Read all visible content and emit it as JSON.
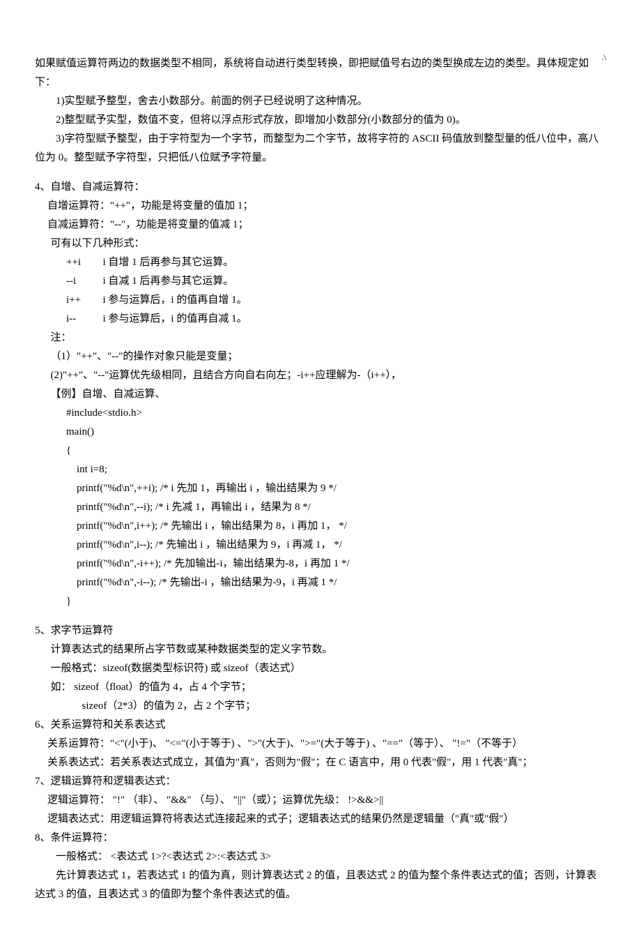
{
  "page_marker": ".\\",
  "intro_line": "如果赋值运算符两边的数据类型不相同，系统将自动进行类型转换，即把赋值号右边的类型换成左边的类型。具体规定如下：",
  "rules": {
    "r1": "1)实型赋予整型，舍去小数部分。前面的例子已经说明了这种情况。",
    "r2": "2)整型赋予实型，数值不变，但将以浮点形式存放，即增加小数部分(小数部分的值为 0)。",
    "r3": "3)字符型赋予整型，由于字符型为一个字节，而整型为二个字节，故将字符的 ASCII 码值放到整型量的低八位中，高八位为 0。整型赋予字符型，只把低八位赋予字符量。"
  },
  "sec4": {
    "title": "4、自增、自减运算符：",
    "bullet": "",
    "item1": "自增运算符：\"++\"，功能是将变量的值加 1；",
    "item2": "自减运算符：\"--\"，功能是将变量的值减 1；",
    "forms_label": "可有以下几种形式：",
    "forms": {
      "f1k": "++i",
      "f1v": "i 自增 1 后再参与其它运算。",
      "f2k": "--i",
      "f2v": "i 自减 1 后再参与其它运算。",
      "f3k": "i++",
      "f3v": "i 参与运算后，i 的值再自增 1。",
      "f4k": "i--",
      "f4v": "i 参与运算后，i 的值再自减 1。"
    },
    "note_label": "注：",
    "note1": "（1）\"++\"、\"--\"的操作对象只能是变量；",
    "note2": "(2)\"++\"、\"--\"运算优先级相同，且结合方向自右向左；-i++应理解为-（i++），",
    "example_label": "【例】自增、自减运算、",
    "code": {
      "l1": "#include<stdio.h>",
      "l2": "main()",
      "l3": "{",
      "l4": "int i=8;",
      "l5": "printf(\"%d\\n\",++i);   /* i 先加 1，再输出 i ，输出结果为 9 */",
      "l6": "printf(\"%d\\n\",--i);    /* i 先减 1，再输出 i ，结果为 8 */",
      "l7": "printf(\"%d\\n\",i++);  /*  先输出 i ，输出结果为 8，i 再加 1，   */",
      "l8": "printf(\"%d\\n\",i--);   /*  先输出 i ，输出结果为 9，i 再减 1，   */",
      "l9": "printf(\"%d\\n\",-i++);  /*  先加输出-i，输出结果为-8，i 再加 1 */",
      "l10": "printf(\"%d\\n\",-i--);   /*  先输出-i ，输出结果为-9，i 再减 1 */",
      "l11": "}"
    }
  },
  "sec5": {
    "title": "5、求字节运算符",
    "line1": "计算表达式的结果所占字节数或某种数据类型的定义字节数。",
    "line2": "一般格式：sizeof(数据类型标识符)    或    sizeof（表达式）",
    "line3": "如：  sizeof（float）的值为 4，占 4 个字节；",
    "line4": "sizeof（2*3）的值为 2，占 2 个字节；"
  },
  "sec6": {
    "title": "6、关系运算符和关系表达式",
    "bullet": "",
    "item1": "关系运算符：\"<\"(小于)、  \"<=\"(小于等于) 、\">\"(大于)、\">=\"(大于等于) 、\"==\"（等于）、  \"!=\"（不等于）",
    "item2": "关系表达式：若关系表达式成立，其值为\"真\"，否则为\"假\"；在 C 语言中，用 0 代表\"假\"，用 1 代表\"真\"；"
  },
  "sec7": {
    "title": "7、逻辑运算符和逻辑表达式：",
    "bullet": "",
    "item1": "逻辑运算符：  \"!\"  （非）、  \"&&\"  （与）、   \"||\"（或）；运算优先级：  !>&&>||",
    "item2": "逻辑表达式：用逻辑运算符将表达式连接起来的式子；逻辑表达式的结果仍然是逻辑量（\"真\"或\"假\"）"
  },
  "sec8": {
    "title": "8、条件运算符：",
    "line1": "一般格式：   <表达式 1>?<表达式 2>:<表达式 3>",
    "line2": "先计算表达式 1，若表达式 1 的值为真，则计算表达式 2 的值，且表达式 2 的值为整个条件表达式的值；否则，计算表达式 3 的值，且表达式 3 的值即为整个条件表达式的值。"
  }
}
